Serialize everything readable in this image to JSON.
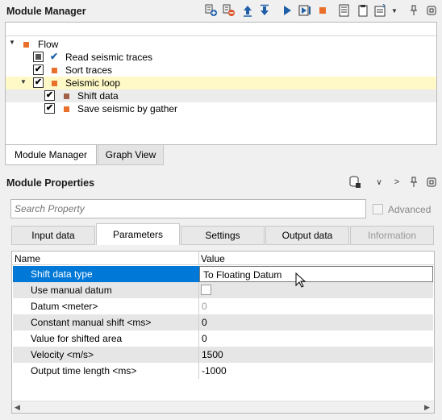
{
  "module_manager": {
    "title": "Module Manager",
    "tree": [
      {
        "label": "Flow",
        "color": "#e8702a"
      },
      {
        "label": "Read seismic traces",
        "color": "#808080",
        "check": "✔"
      },
      {
        "label": "Sort traces",
        "color": "#e8702a",
        "check": "✔"
      },
      {
        "label": "Seismic loop",
        "color": "#e8702a",
        "check": "✔"
      },
      {
        "label": "Shift data",
        "color": "#a06048",
        "check": "✔"
      },
      {
        "label": "Save seismic by gather",
        "color": "#e8702a",
        "check": "✔"
      }
    ],
    "bottom_tabs": [
      "Module Manager",
      "Graph View"
    ]
  },
  "module_properties": {
    "title": "Module Properties",
    "search_placeholder": "Search Property",
    "advanced_label": "Advanced",
    "tabs": [
      "Input data",
      "Parameters",
      "Settings",
      "Output data",
      "Information"
    ],
    "columns": [
      "Name",
      "Value"
    ],
    "rows": [
      {
        "name": "Shift data type",
        "value": "To Floating Datum"
      },
      {
        "name": "Use manual datum",
        "value": ""
      },
      {
        "name": "Datum <meter>",
        "value": "0"
      },
      {
        "name": "Constant manual shift <ms>",
        "value": "0"
      },
      {
        "name": "Value for shifted area",
        "value": "0"
      },
      {
        "name": "Velocity <m/s>",
        "value": "1500"
      },
      {
        "name": "Output time length <ms>",
        "value": "-1000"
      }
    ]
  },
  "colors": {
    "accent": "#0078d7",
    "highlight_row": "#fff9c8",
    "orange": "#e8702a"
  }
}
